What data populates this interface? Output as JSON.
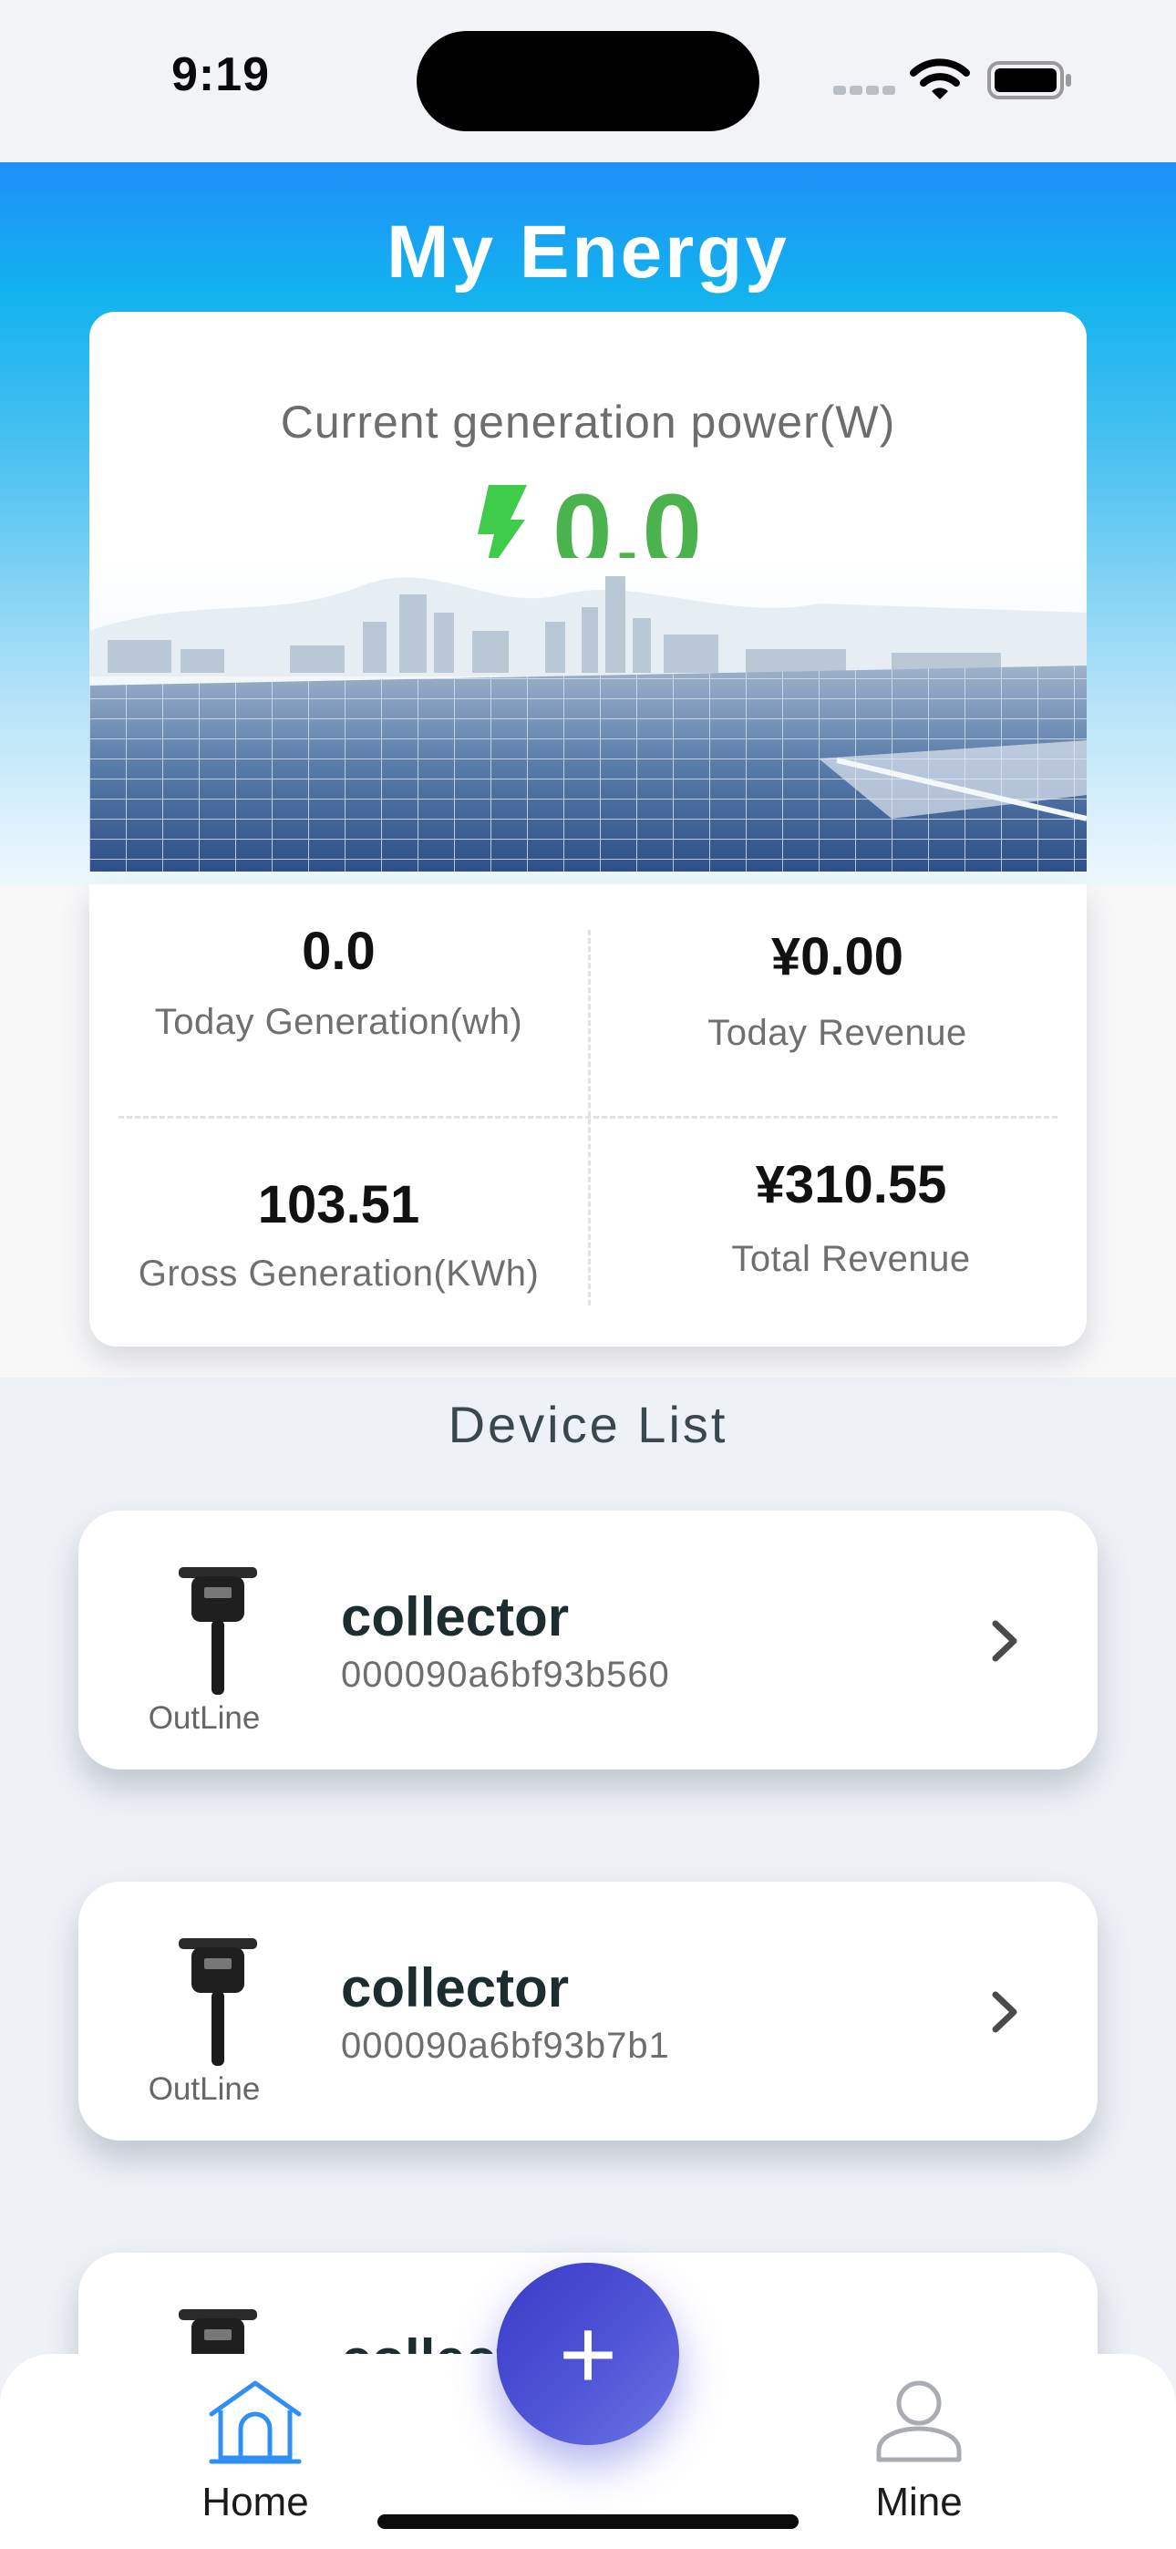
{
  "status_bar": {
    "time": "9:19"
  },
  "header": {
    "title": "My Energy"
  },
  "power": {
    "label": "Current generation power(W)",
    "value": "0.0",
    "accent_color": "#4ab34e"
  },
  "stats": {
    "today_generation": {
      "value": "0.0",
      "label": "Today Generation(wh)"
    },
    "today_revenue": {
      "value": "¥0.00",
      "label": "Today Revenue"
    },
    "gross_generation": {
      "value": "103.51",
      "label": "Gross Generation(KWh)"
    },
    "total_revenue": {
      "value": "¥310.55",
      "label": "Total Revenue"
    }
  },
  "device_list": {
    "title": "Device List",
    "devices": [
      {
        "name": "collector",
        "id": "000090a6bf93b560",
        "status": "OutLine",
        "icon": "collector-device-icon"
      },
      {
        "name": "collector",
        "id": "000090a6bf93b7b1",
        "status": "OutLine",
        "icon": "collector-device-icon"
      },
      {
        "name": "collector",
        "id": "",
        "status": "",
        "icon": "collector-device-icon"
      }
    ]
  },
  "tab_bar": {
    "home_label": "Home",
    "mine_label": "Mine",
    "add_label": "+",
    "active_color": "#2f8ff5"
  }
}
